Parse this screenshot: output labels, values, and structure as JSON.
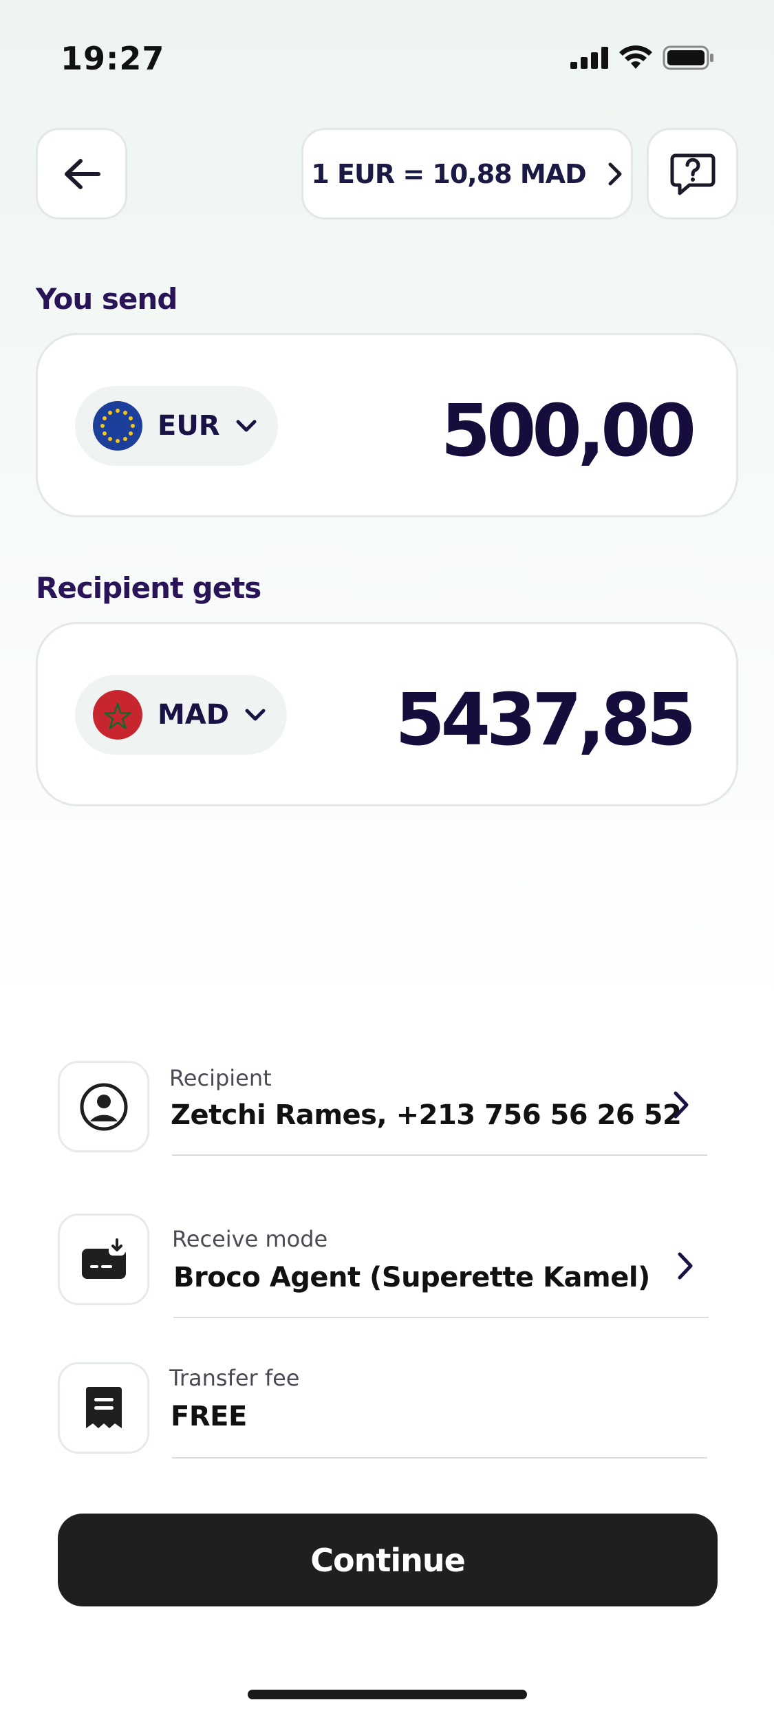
{
  "status_bar": {
    "time": "19:27"
  },
  "header": {
    "rate_label": "1 EUR = 10,88 MAD"
  },
  "send": {
    "section_label": "You send",
    "currency": "EUR",
    "amount": "500,00"
  },
  "receive": {
    "section_label": "Recipient gets",
    "currency": "MAD",
    "amount": "5437,85"
  },
  "details": {
    "recipient": {
      "label": "Recipient",
      "value": "Zetchi Rames, +213 756 56 26 52"
    },
    "receive_mode": {
      "label": "Receive mode",
      "value": "Broco Agent (Superette Kamel)"
    },
    "transfer_fee": {
      "label": "Transfer fee",
      "value": "FREE"
    }
  },
  "continue_label": "Continue",
  "colors": {
    "accent_text": "#2a1458",
    "amount_text": "#160d3d",
    "button_bg": "#1f1f1f"
  }
}
